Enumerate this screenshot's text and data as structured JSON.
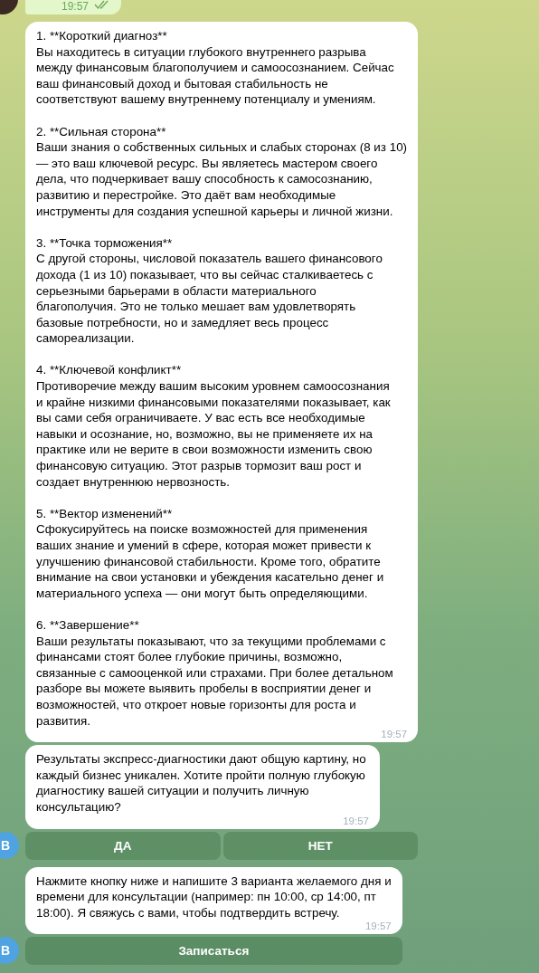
{
  "top_message": {
    "time": "19:57",
    "read": true,
    "avatar": {
      "kind": "photo"
    }
  },
  "groups": [
    {
      "avatar": {
        "kind": "letter",
        "letter": "В",
        "color": "#4fa3e0"
      },
      "messages": [
        {
          "kind": "sections",
          "time": "19:57",
          "sections": [
            {
              "heading": "1. **Короткий диагноз**",
              "body": "Вы находитесь в ситуации глубокого внутреннего разрыва\nмежду финансовым благополучием и самоосознанием. Сейчас\nваш финансовый доход и бытовая стабильность не\nсоответствуют вашему внутреннему потенциалу и умениям."
            },
            {
              "heading": "2. **Сильная сторона**",
              "body": "Ваши знания о собственных сильных и слабых сторонах (8 из 10)\n— это ваш ключевой ресурс. Вы являетесь мастером своего\nдела, что подчеркивает вашу способность к самосознанию,\nразвитию и перестройке. Это даёт вам необходимые\nинструменты для создания успешной карьеры и личной жизни."
            },
            {
              "heading": "3. **Точка торможения**",
              "body": "С другой стороны, числовой показатель вашего финансового\nдохода (1 из 10) показывает, что вы сейчас сталкиваетесь с\nсерьезными барьерами в области материального\nблагополучия. Это не только мешает вам удовлетворять\nбазовые потребности, но и замедляет весь процесс\nсамореализации."
            },
            {
              "heading": "4. **Ключевой конфликт**",
              "body": "Противоречие между вашим высоким уровнем самоосознания\nи крайне низкими финансовыми показателями показывает, как\nвы сами себя ограничиваете. У вас есть все необходимые\nнавыки и осознание, но, возможно, вы не применяете их на\nпрактике или не верите в свои возможности изменить свою\nфинансовую ситуацию. Этот разрыв тормозит ваш рост и\nсоздает внутреннюю нервозность."
            },
            {
              "heading": "5. **Вектор изменений**",
              "body": "Сфокусируйтесь на поиске возможностей для применения\nваших знание и умений в сфере, которая может привести к\nулучшению финансовой стабильности. Кроме того, обратите\nвнимание на свои установки и убеждения касательно денег и\nматериального успеха — они могут быть определяющими."
            },
            {
              "heading": "6. **Завершение**",
              "body": "Ваши результаты показывают, что за текущими проблемами с\nфинансами стоят более глубокие причины, возможно,\nсвязанные с самооценкой или страхами. При более детальном\nразборе вы можете выявить пробелы в восприятии денег и\nвозможностей, что откроет новые горизонты для роста и\nразвития."
            }
          ]
        },
        {
          "kind": "text",
          "time": "19:57",
          "text": "Результаты экспресс-диагностики дают общую картину, но\nкаждый бизнес уникален. Хотите пройти полную глубокую\nдиагностику вашей ситуации и получить личную\nконсультацию?"
        }
      ],
      "buttons": [
        [
          "ДА",
          "НЕТ"
        ]
      ]
    },
    {
      "avatar": {
        "kind": "letter",
        "letter": "В",
        "color": "#4fa3e0"
      },
      "messages": [
        {
          "kind": "text",
          "time": "19:57",
          "text": "Нажмите кнопку ниже и напишите 3 варианта желаемого дня и\nвремени для консультации (например: пн 10:00, ср 14:00, пт\n18:00). Я свяжусь с вами, чтобы подтвердить встречу."
        }
      ],
      "buttons": [
        [
          "Записаться"
        ]
      ]
    }
  ]
}
